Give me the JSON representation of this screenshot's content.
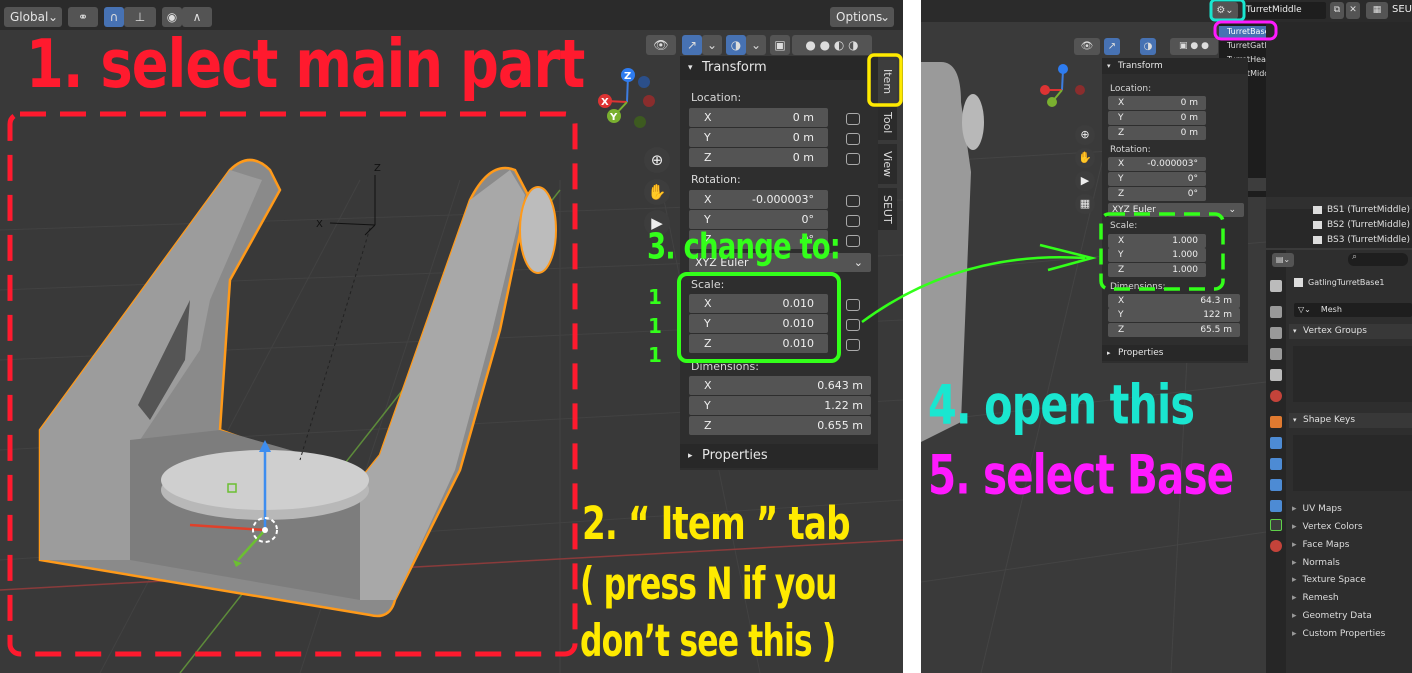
{
  "left_panel": {
    "toolbar": {
      "orientation": "Global",
      "options": "Options"
    },
    "npanel": {
      "tabs": [
        "Item",
        "Tool",
        "View",
        "SEUT"
      ],
      "transform_header": "Transform",
      "location_label": "Location:",
      "location": [
        {
          "axis": "X",
          "value": "0 m"
        },
        {
          "axis": "Y",
          "value": "0 m"
        },
        {
          "axis": "Z",
          "value": "0 m"
        }
      ],
      "rotation_label": "Rotation:",
      "rotation": [
        {
          "axis": "X",
          "value": "-0.000003°"
        },
        {
          "axis": "Y",
          "value": "0°"
        },
        {
          "axis": "Z",
          "value": "0°"
        }
      ],
      "rotation_mode": "XYZ Euler",
      "scale_label": "Scale:",
      "scale": [
        {
          "axis": "X",
          "value": "0.010"
        },
        {
          "axis": "Y",
          "value": "0.010"
        },
        {
          "axis": "Z",
          "value": "0.010"
        }
      ],
      "dimensions_label": "Dimensions:",
      "dimensions": [
        {
          "axis": "X",
          "value": "0.643 m"
        },
        {
          "axis": "Y",
          "value": "1.22 m"
        },
        {
          "axis": "Z",
          "value": "0.655 m"
        }
      ],
      "properties_header": "Properties"
    },
    "gizmo": {
      "x": "X",
      "y": "Y",
      "z": "Z"
    },
    "empty_axes": {
      "x": "X",
      "z": "Z"
    }
  },
  "right_panel": {
    "collection_field": "TurretMiddle",
    "seut_label": "SEUT",
    "dropdown_items": [
      "TurretBase",
      "TurretGatling",
      "TurretHead",
      "TurretMiddle"
    ],
    "npanel": {
      "transform_header": "Transform",
      "location_label": "Location:",
      "location": [
        {
          "axis": "X",
          "value": "0 m"
        },
        {
          "axis": "Y",
          "value": "0 m"
        },
        {
          "axis": "Z",
          "value": "0 m"
        }
      ],
      "rotation_label": "Rotation:",
      "rotation": [
        {
          "axis": "X",
          "value": "-0.000003°"
        },
        {
          "axis": "Y",
          "value": "0°"
        },
        {
          "axis": "Z",
          "value": "0°"
        }
      ],
      "rotation_mode": "XYZ Euler",
      "scale_label": "Scale:",
      "scale": [
        {
          "axis": "X",
          "value": "1.000"
        },
        {
          "axis": "Y",
          "value": "1.000"
        },
        {
          "axis": "Z",
          "value": "1.000"
        }
      ],
      "dimensions_label": "Dimensions:",
      "dimensions": [
        {
          "axis": "X",
          "value": "64.3 m"
        },
        {
          "axis": "Y",
          "value": "122 m"
        },
        {
          "axis": "Z",
          "value": "65.5 m"
        }
      ],
      "properties_header": "Properties"
    },
    "outliner": [
      "BS1 (TurretMiddle)",
      "BS2 (TurretMiddle)",
      "BS3 (TurretMiddle)"
    ],
    "properties": {
      "object_name": "GatlingTurretBase1",
      "mesh_name": "Mesh",
      "vertex_groups": "Vertex Groups",
      "shape_keys": "Shape Keys",
      "panels": [
        "UV Maps",
        "Vertex Colors",
        "Face Maps",
        "Normals",
        "Texture Space",
        "Remesh",
        "Geometry Data",
        "Custom Properties"
      ]
    }
  },
  "annotations": {
    "step1": "1. select main part",
    "step2_line1": "2. “ Item ” tab",
    "step2_line2": "( press N if you",
    "step2_line3": "don’t see this )",
    "step3": "3. change to:",
    "step3_values": [
      "1",
      "1",
      "1"
    ],
    "step4": "4. open this",
    "step5": "5. select Base"
  },
  "colors": {
    "step1": "#ff1a2e",
    "step2": "#ffea00",
    "step3": "#33ff1a",
    "step4": "#1ae6d0",
    "step5": "#ff1aff",
    "selection_outline": "#ff9a1a"
  }
}
